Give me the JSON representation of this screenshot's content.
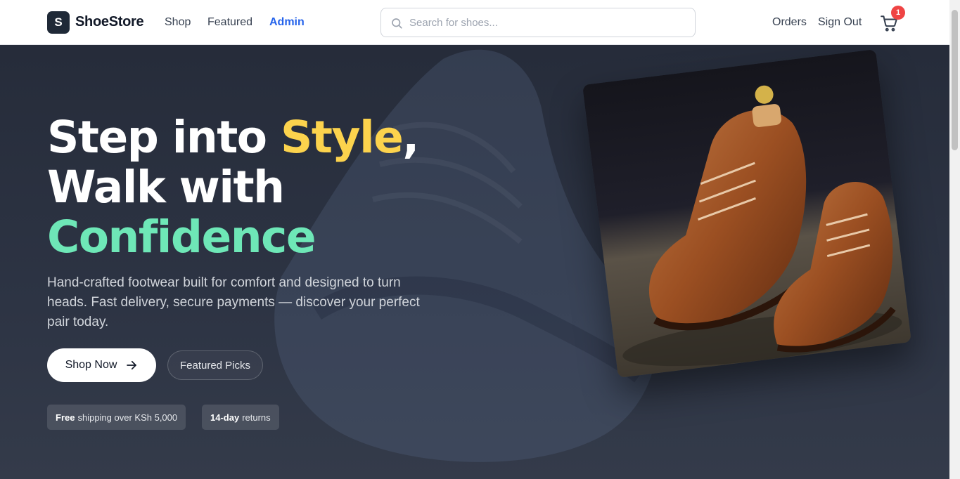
{
  "brand": {
    "initial": "S",
    "name": "ShoeStore"
  },
  "nav": {
    "shop": "Shop",
    "featured": "Featured",
    "admin": "Admin"
  },
  "search": {
    "placeholder": "Search for shoes..."
  },
  "account": {
    "orders": "Orders",
    "sign_out": "Sign Out"
  },
  "cart": {
    "count": "1"
  },
  "hero": {
    "line1_a": "Step into ",
    "line1_b": "Style",
    "line1_c": ",",
    "line2": "Walk with",
    "line3": "Confidence",
    "subtitle": "Hand-crafted footwear built for comfort and designed to turn heads. Fast delivery, secure payments — discover your perfect pair today.",
    "primary_cta": "Shop Now",
    "secondary_cta": "Featured Picks",
    "chip1_bold": "Free",
    "chip1_rest": "shipping over KSh 5,000",
    "chip2_bold": "14-day",
    "chip2_rest": "returns"
  },
  "colors": {
    "accent_blue": "#2563eb",
    "highlight_yellow": "#fcd34d",
    "highlight_green": "#6ee7b7",
    "badge_red": "#ef4444",
    "hero_bg": "#2a3040"
  },
  "icons": [
    "search-icon",
    "cart-icon",
    "arrow-right-icon"
  ]
}
